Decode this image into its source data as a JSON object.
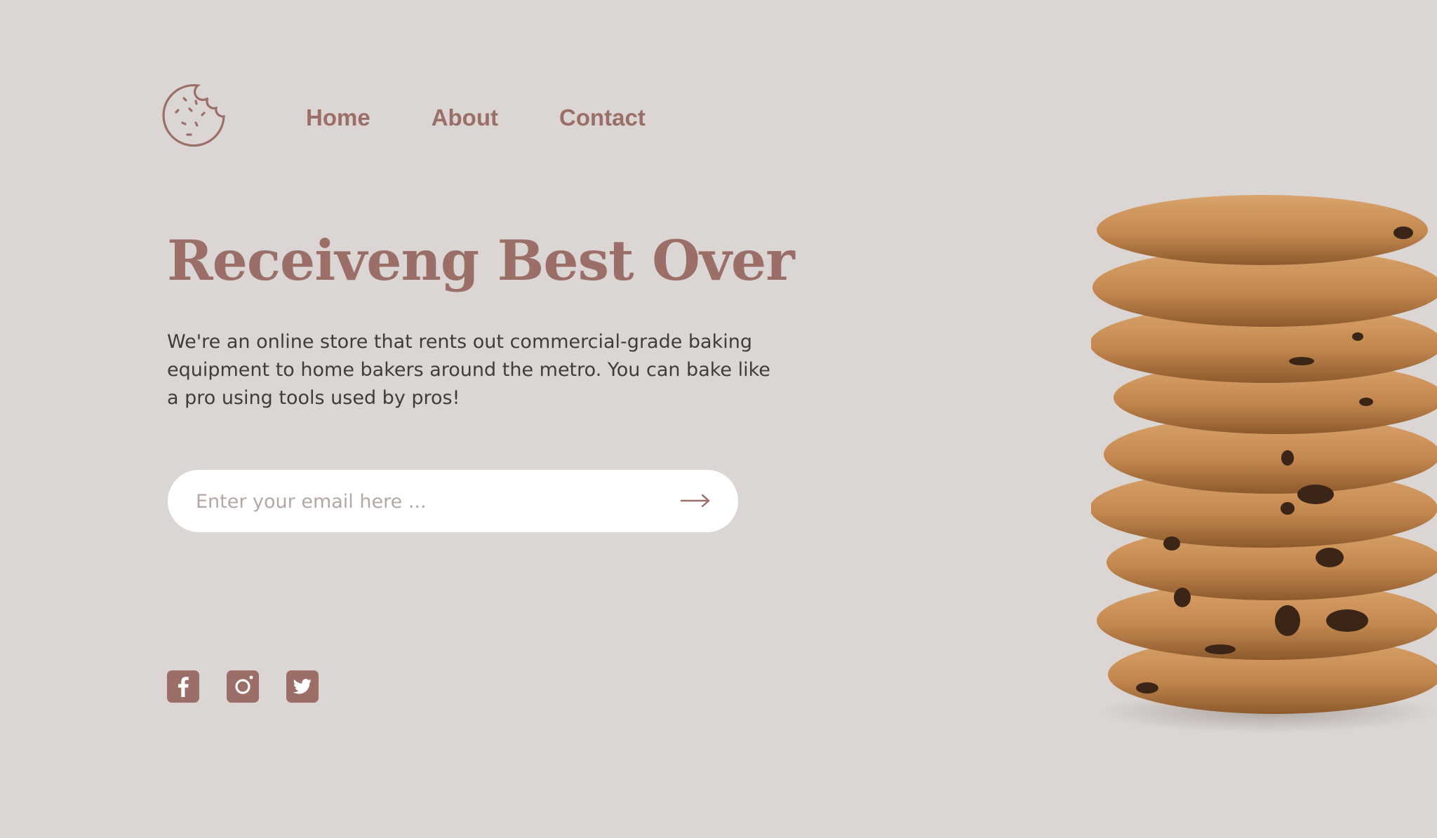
{
  "brand": {
    "logo_icon": "cookie-icon"
  },
  "nav": {
    "items": [
      {
        "label": "Home"
      },
      {
        "label": "About"
      },
      {
        "label": "Contact"
      }
    ]
  },
  "hero": {
    "title": "Receiveng Best Over",
    "description": "We're an online store that rents out commercial-grade baking equipment to home bakers around the metro. You can bake like a pro using tools used by pros!"
  },
  "signup": {
    "email_placeholder": "Enter your email here ...",
    "submit_icon": "arrow-right-icon"
  },
  "social": {
    "icons": [
      "facebook-icon",
      "instagram-icon",
      "twitter-icon"
    ]
  },
  "hero_image": {
    "icon": "cookie-stack-image"
  },
  "colors": {
    "background": "#dbd6d3",
    "accent": "#9b6f68",
    "text": "#3f3c3b",
    "input_bg": "#ffffff",
    "placeholder": "#b3a8a4"
  }
}
